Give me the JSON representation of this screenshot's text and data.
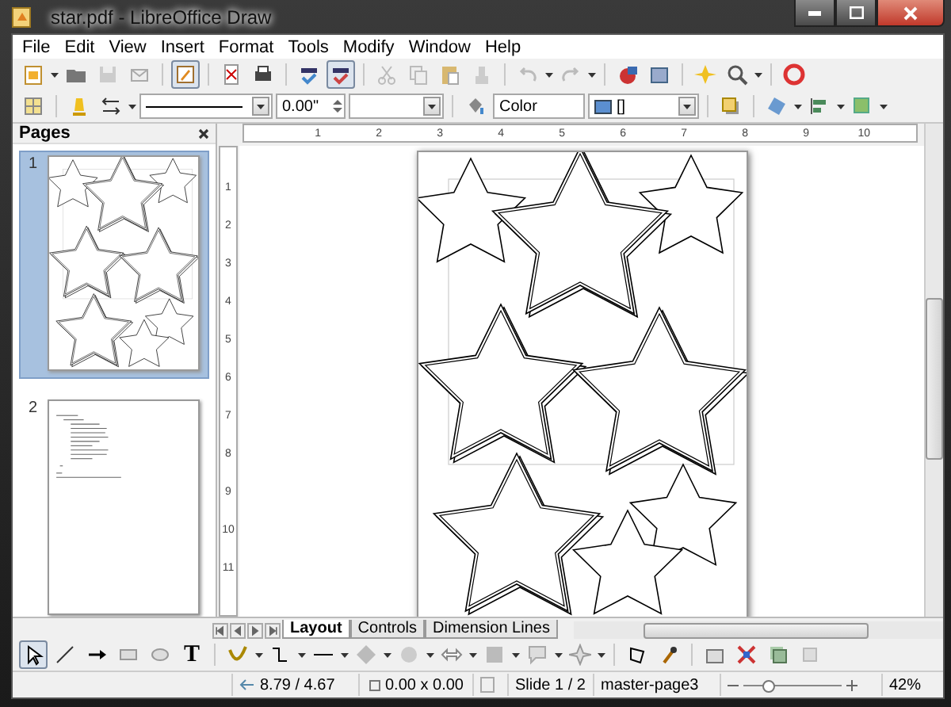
{
  "window": {
    "title": "star.pdf - LibreOffice Draw"
  },
  "menu": [
    "File",
    "Edit",
    "View",
    "Insert",
    "Format",
    "Tools",
    "Modify",
    "Window",
    "Help"
  ],
  "standard_toolbar": {
    "edit_file_pressed": true,
    "autospell_pressed": true
  },
  "line_fill_toolbar": {
    "line_width": "0.00\"",
    "area_style": "Color",
    "area_fill": "[]"
  },
  "pages_panel": {
    "title": "Pages",
    "pages": [
      {
        "number": "1",
        "selected": true
      },
      {
        "number": "2",
        "selected": false
      }
    ]
  },
  "rulers": {
    "horizontal": [
      "1",
      "2",
      "3",
      "4",
      "5",
      "6",
      "7",
      "8",
      "9",
      "10"
    ],
    "vertical": [
      "1",
      "2",
      "3",
      "4",
      "5",
      "6",
      "7",
      "8",
      "9",
      "10",
      "11"
    ]
  },
  "layer_tabs": [
    {
      "label": "Layout",
      "selected": true
    },
    {
      "label": "Controls",
      "selected": false
    },
    {
      "label": "Dimension Lines",
      "selected": false
    }
  ],
  "drawing_toolbar": {
    "select_pressed": true,
    "text_tool": "T"
  },
  "status_bar": {
    "position": "8.79 / 4.67",
    "size": "0.00 x 0.00",
    "slide": "Slide 1 / 2",
    "master": "master-page3",
    "zoom": {
      "level": 0.25,
      "reading": "42%"
    }
  }
}
